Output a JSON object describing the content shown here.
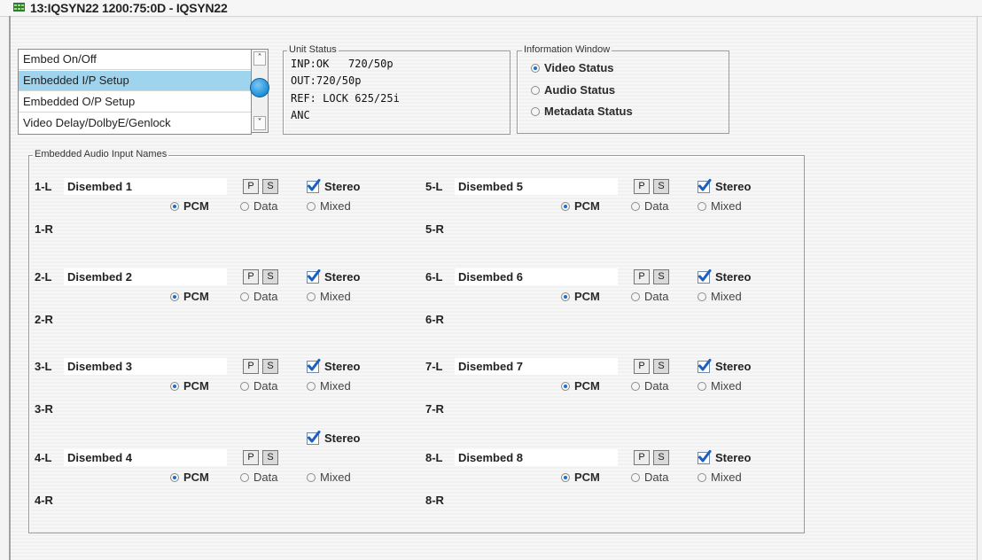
{
  "window": {
    "title": "13:IQSYN22  1200:75:0D  - IQSYN22"
  },
  "menu": {
    "items": [
      {
        "label": "Embed On/Off"
      },
      {
        "label": "Embedded I/P Setup"
      },
      {
        "label": "Embedded O/P Setup"
      },
      {
        "label": "Video Delay/DolbyE/Genlock"
      }
    ],
    "selected_index": 1
  },
  "unit_status": {
    "legend": "Unit Status",
    "lines": [
      "INP:OK   720/50p",
      "OUT:720/50p",
      "REF: LOCK 625/25i",
      "ANC"
    ]
  },
  "info_window": {
    "legend": "Information Window",
    "options": [
      {
        "label": "Video Status",
        "selected": true
      },
      {
        "label": "Audio Status",
        "selected": false
      },
      {
        "label": "Metadata Status",
        "selected": false
      }
    ]
  },
  "audio_group": {
    "legend": "Embedded Audio Input Names",
    "stereo_label": "Stereo",
    "p_label": "P",
    "s_label": "S",
    "mode_labels": {
      "pcm": "PCM",
      "data": "Data",
      "mixed": "Mixed"
    },
    "channels": [
      {
        "left": "1-L",
        "right": "1-R",
        "name": "Disembed 1",
        "stereo": true,
        "mode": "pcm"
      },
      {
        "left": "2-L",
        "right": "2-R",
        "name": "Disembed 2",
        "stereo": true,
        "mode": "pcm"
      },
      {
        "left": "3-L",
        "right": "3-R",
        "name": "Disembed 3",
        "stereo": true,
        "mode": "pcm"
      },
      {
        "left": "4-L",
        "right": "4-R",
        "name": "Disembed 4",
        "stereo": true,
        "mode": "pcm"
      },
      {
        "left": "5-L",
        "right": "5-R",
        "name": "Disembed 5",
        "stereo": true,
        "mode": "pcm"
      },
      {
        "left": "6-L",
        "right": "6-R",
        "name": "Disembed 6",
        "stereo": true,
        "mode": "pcm"
      },
      {
        "left": "7-L",
        "right": "7-R",
        "name": "Disembed 7",
        "stereo": true,
        "mode": "pcm"
      },
      {
        "left": "8-L",
        "right": "8-R",
        "name": "Disembed 8",
        "stereo": true,
        "mode": "pcm"
      }
    ]
  },
  "colors": {
    "selection": "#9fd4ef",
    "radio_dot": "#1d6fc4",
    "check_mark": "#1b5fbf"
  }
}
